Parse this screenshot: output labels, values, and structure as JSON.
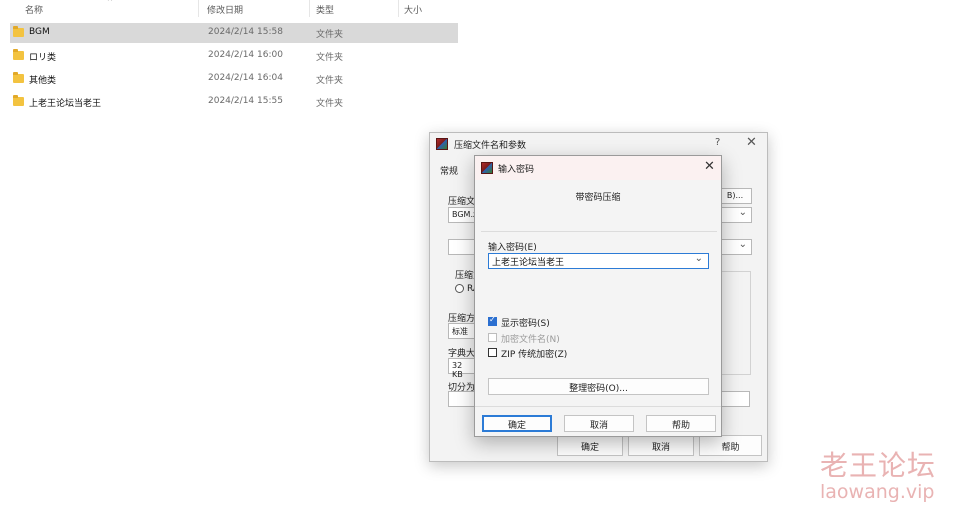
{
  "explorer": {
    "columns": [
      "名称",
      "修改日期",
      "类型",
      "大小"
    ],
    "rows": [
      {
        "name": "BGM",
        "date": "2024/2/14 15:58",
        "type": "文件夹",
        "selected": true
      },
      {
        "name": "ロリ类",
        "date": "2024/2/14 16:00",
        "type": "文件夹",
        "selected": false
      },
      {
        "name": "其他类",
        "date": "2024/2/14 16:04",
        "type": "文件夹",
        "selected": false
      },
      {
        "name": "上老王论坛当老王",
        "date": "2024/2/14 15:55",
        "type": "文件夹",
        "selected": false
      }
    ]
  },
  "archive_dialog": {
    "title": "压缩文件名和参数",
    "help": "?",
    "close": "✕",
    "tab": "常规",
    "filename_label": "压缩文",
    "filename_value": "BGM.zi",
    "browse_label": "B)...",
    "format_label": "压缩方",
    "format_radio": "RA",
    "method_label": "压缩方",
    "method_value": "标准",
    "dict_label": "字典大",
    "dict_value": "32 KB",
    "split_label": "切分为",
    "ok": "确定",
    "cancel": "取消",
    "help_button": "帮助"
  },
  "password_dialog": {
    "title": "输入密码",
    "close": "✕",
    "heading": "带密码压缩",
    "password_label": "输入密码(E)",
    "password_value": "上老王论坛当老王",
    "options": [
      {
        "label": "显示密码(S)",
        "checked": true,
        "enabled": true
      },
      {
        "label": "加密文件名(N)",
        "checked": false,
        "enabled": false
      },
      {
        "label": "ZIP 传统加密(Z)",
        "checked": false,
        "enabled": true
      }
    ],
    "manage_button": "整理密码(O)...",
    "ok": "确定",
    "cancel": "取消",
    "help": "帮助"
  },
  "watermark": {
    "chinese": "老王论坛",
    "domain": "laowang.vip"
  }
}
